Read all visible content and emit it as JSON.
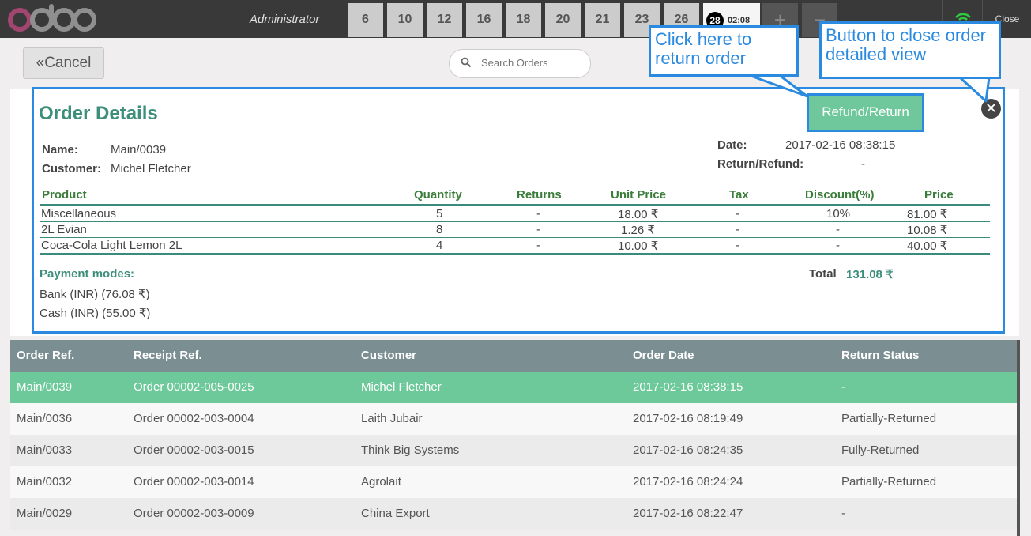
{
  "topbar": {
    "user": "Administrator",
    "order_tabs": [
      "6",
      "10",
      "12",
      "16",
      "18",
      "20",
      "21",
      "23",
      "26"
    ],
    "active_tab": {
      "number": "28",
      "time": "02:08"
    },
    "add_label": "+",
    "remove_label": "−",
    "close_label": "Close"
  },
  "toolbar": {
    "cancel_label": "Cancel",
    "search_placeholder": "Search Orders"
  },
  "details": {
    "title": "Order Details",
    "refund_label": "Refund/Return",
    "close_symbol": "✕",
    "name_label": "Name:",
    "name_value": "Main/0039",
    "customer_label": "Customer:",
    "customer_value": "Michel Fletcher",
    "date_label": "Date:",
    "date_value": "2017-02-16 08:38:15",
    "return_label": "Return/Refund:",
    "return_value": "-",
    "product_headers": [
      "Product",
      "Quantity",
      "Returns",
      "Unit Price",
      "Tax",
      "Discount(%)",
      "Price"
    ],
    "products": [
      [
        "Miscellaneous",
        "5",
        "-",
        "18.00 ₹",
        "-",
        "10%",
        "81.00 ₹"
      ],
      [
        "2L Evian",
        "8",
        "-",
        "1.26 ₹",
        "-",
        "-",
        "10.08 ₹"
      ],
      [
        "Coca-Cola Light Lemon 2L",
        "4",
        "-",
        "10.00 ₹",
        "-",
        "-",
        "40.00 ₹"
      ]
    ],
    "payment_title": "Payment modes:",
    "payments": [
      "Bank (INR) (76.08 ₹)",
      "Cash (INR) (55.00 ₹)"
    ],
    "total_label": "Total",
    "total_value": "131.08 ₹"
  },
  "callouts": {
    "return_order": "Click here to return order",
    "close_view": "Button to close order detailed view"
  },
  "orders": {
    "headers": [
      "Order Ref.",
      "Receipt Ref.",
      "Customer",
      "Order Date",
      "Return Status"
    ],
    "rows": [
      [
        "Main/0039",
        "Order 00002-005-0025",
        "Michel Fletcher",
        "2017-02-16 08:38:15",
        "-"
      ],
      [
        "Main/0036",
        "Order 00002-003-0004",
        "Laith Jubair",
        "2017-02-16 08:19:49",
        "Partially-Returned"
      ],
      [
        "Main/0033",
        "Order 00002-003-0015",
        "Think Big Systems",
        "2017-02-16 08:24:35",
        "Fully-Returned"
      ],
      [
        "Main/0032",
        "Order 00002-003-0014",
        "Agrolait",
        "2017-02-16 08:24:24",
        "Partially-Returned"
      ],
      [
        "Main/0029",
        "Order 00002-003-0009",
        "China Export",
        "2017-02-16 08:22:47",
        "-"
      ]
    ]
  },
  "colors": {
    "accent": "#3d8e7b",
    "selected_row": "#6dc99a",
    "callout_blue": "#2a8ae0",
    "header_bar": "#393939"
  }
}
